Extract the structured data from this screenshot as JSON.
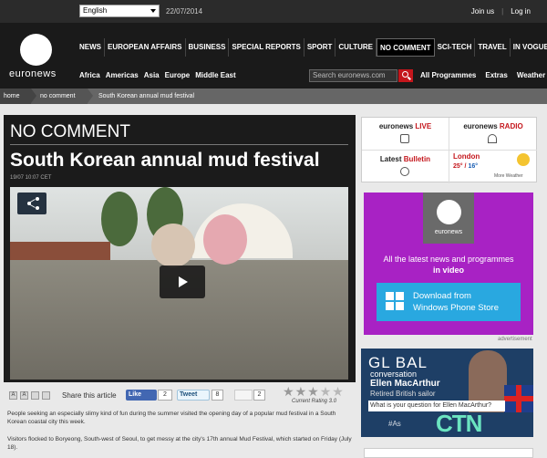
{
  "topbar": {
    "language": "English",
    "date": "22/07/2014",
    "join": "Join us",
    "login": "Log in"
  },
  "logo": {
    "text": "euronews"
  },
  "nav": {
    "items": [
      {
        "label": "NEWS"
      },
      {
        "label": "EUROPEAN AFFAIRS"
      },
      {
        "label": "BUSINESS"
      },
      {
        "label": "SPECIAL REPORTS"
      },
      {
        "label": "SPORT"
      },
      {
        "label": "CULTURE"
      },
      {
        "label": "NO COMMENT",
        "active": true
      },
      {
        "label": "SCI-TECH"
      },
      {
        "label": "TRAVEL"
      },
      {
        "label": "IN VOGUE"
      }
    ],
    "regions": [
      "Africa",
      "Americas",
      "Asia",
      "Europe",
      "Middle East"
    ],
    "search_placeholder": "Search euronews.com",
    "extras": [
      "All Programmes",
      "Extras",
      "Weather"
    ]
  },
  "breadcrumb": [
    "home",
    "no comment",
    "South Korean annual mud festival"
  ],
  "article": {
    "section": "NO COMMENT",
    "headline": "South Korean annual mud festival",
    "timestamp": "19/07 10:07 CET",
    "share_label": "Share this article",
    "fb_like": "Like",
    "fb_count": "2",
    "tweet": "Tweet",
    "tweet_count": "8",
    "gplus_count": "2",
    "rating_text": "Current Rating 3.0",
    "rating": 3,
    "rating_max": 5,
    "paragraphs": [
      "People seeking an especially slimy kind of fun during the summer visited the opening day of a popular mud festival in a South Korean coastal city this week.",
      "Visitors flocked to Boryeong, South-west of Seoul, to get messy at the city's 17th annual Mud Festival, which started on Friday (July 18)."
    ]
  },
  "sidebar": {
    "live": {
      "prefix": "euronews",
      "suffix": "LIVE"
    },
    "radio": {
      "prefix": "euronews",
      "suffix": "RADIO"
    },
    "bulletin": {
      "prefix": "Latest",
      "suffix": "Bulletin"
    },
    "weather": {
      "city": "London",
      "high": "25°",
      "low": "16°",
      "more": "More Weather"
    }
  },
  "ad_windows": {
    "logo_text": "euronews",
    "line1": "All the latest news and programmes",
    "line2": "in video",
    "button_line1": "Download from",
    "button_line2": "Windows Phone Store",
    "advertisement": "advertisement"
  },
  "ad_global": {
    "title": "GL    BAL",
    "subtitle": "conversation",
    "guest": "Ellen MacArthur",
    "role": "Retired British sailor",
    "question": "What is your question for Ellen MacArthur?",
    "hashtag": "#As",
    "brand": "CTN"
  },
  "colors": {
    "accent_red": "#c4161c",
    "purple_ad": "#a822c4",
    "windows_blue": "#29a8e0"
  }
}
